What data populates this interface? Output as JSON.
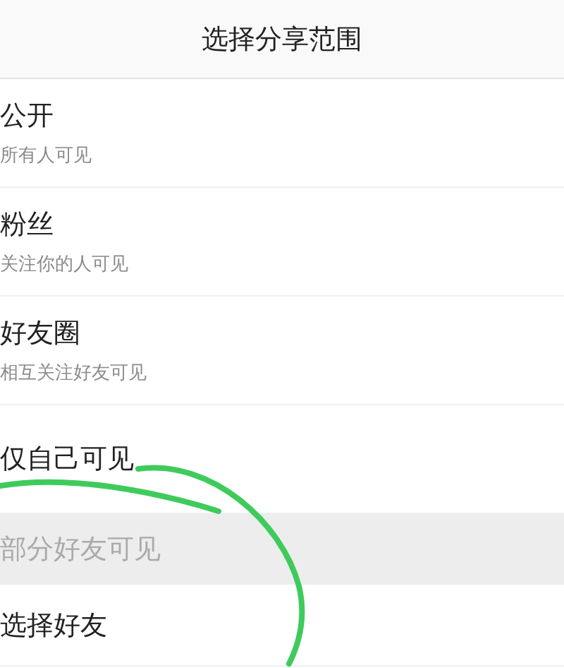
{
  "header": {
    "title": "选择分享范围"
  },
  "options": [
    {
      "kind": "option",
      "title": "公开",
      "subtitle": "所有人可见"
    },
    {
      "kind": "option",
      "title": "粉丝",
      "subtitle": "关注你的人可见"
    },
    {
      "kind": "option",
      "title": "好友圈",
      "subtitle": "相互关注好友可见"
    },
    {
      "kind": "option",
      "title": "仅自己可见"
    },
    {
      "kind": "section",
      "title": "部分好友可见"
    },
    {
      "kind": "option",
      "title": "选择好友"
    }
  ]
}
